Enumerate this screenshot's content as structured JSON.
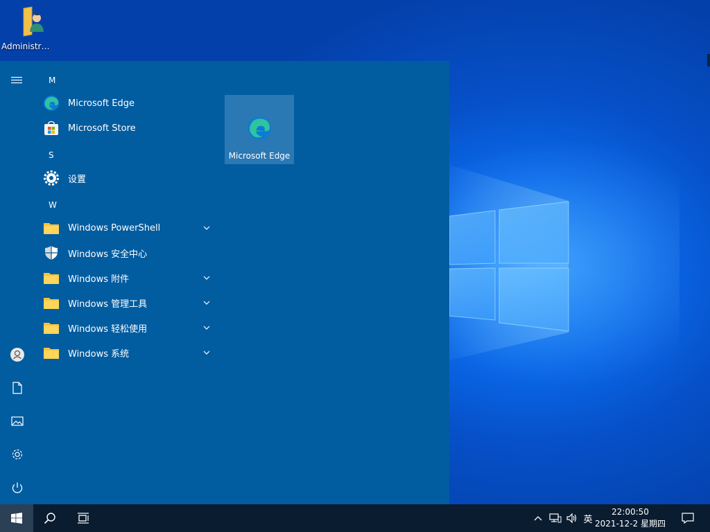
{
  "desktop": {
    "icon_label": "Administra..."
  },
  "start_menu": {
    "sections": [
      {
        "letter": "M"
      },
      {
        "letter": "S"
      },
      {
        "letter": "W"
      }
    ],
    "apps": [
      {
        "label": "Microsoft Edge",
        "icon": "edge-icon"
      },
      {
        "label": "Microsoft Store",
        "icon": "store-icon"
      },
      {
        "label": "设置",
        "icon": "settings-gear-icon"
      },
      {
        "label": "Windows PowerShell",
        "icon": "folder-icon",
        "expandable": true
      },
      {
        "label": "Windows 安全中心",
        "icon": "shield-icon"
      },
      {
        "label": "Windows 附件",
        "icon": "folder-icon",
        "expandable": true
      },
      {
        "label": "Windows 管理工具",
        "icon": "folder-icon",
        "expandable": true
      },
      {
        "label": "Windows 轻松使用",
        "icon": "folder-icon",
        "expandable": true
      },
      {
        "label": "Windows 系统",
        "icon": "folder-icon",
        "expandable": true
      }
    ],
    "tiles": [
      {
        "label": "Microsoft Edge",
        "icon": "edge-icon"
      }
    ],
    "rail_icons": [
      "hamburger-icon",
      "user-icon",
      "document-icon",
      "pictures-icon",
      "settings-icon",
      "power-icon"
    ]
  },
  "taskbar": {
    "clock_time": "22:00:50",
    "clock_date": "2021-12-2 星期四",
    "ime_label": "英",
    "icons": [
      "windows-start-icon",
      "search-icon",
      "task-view-icon",
      "show-hidden-icons-chevron",
      "network-icon",
      "volume-icon",
      "notification-icon"
    ]
  },
  "colors": {
    "start_menu_bg": "#025ca0",
    "tile_bg": "#2a78b4",
    "taskbar_bg": "#0a1c30",
    "folder_yellow": "#f8c33c"
  }
}
